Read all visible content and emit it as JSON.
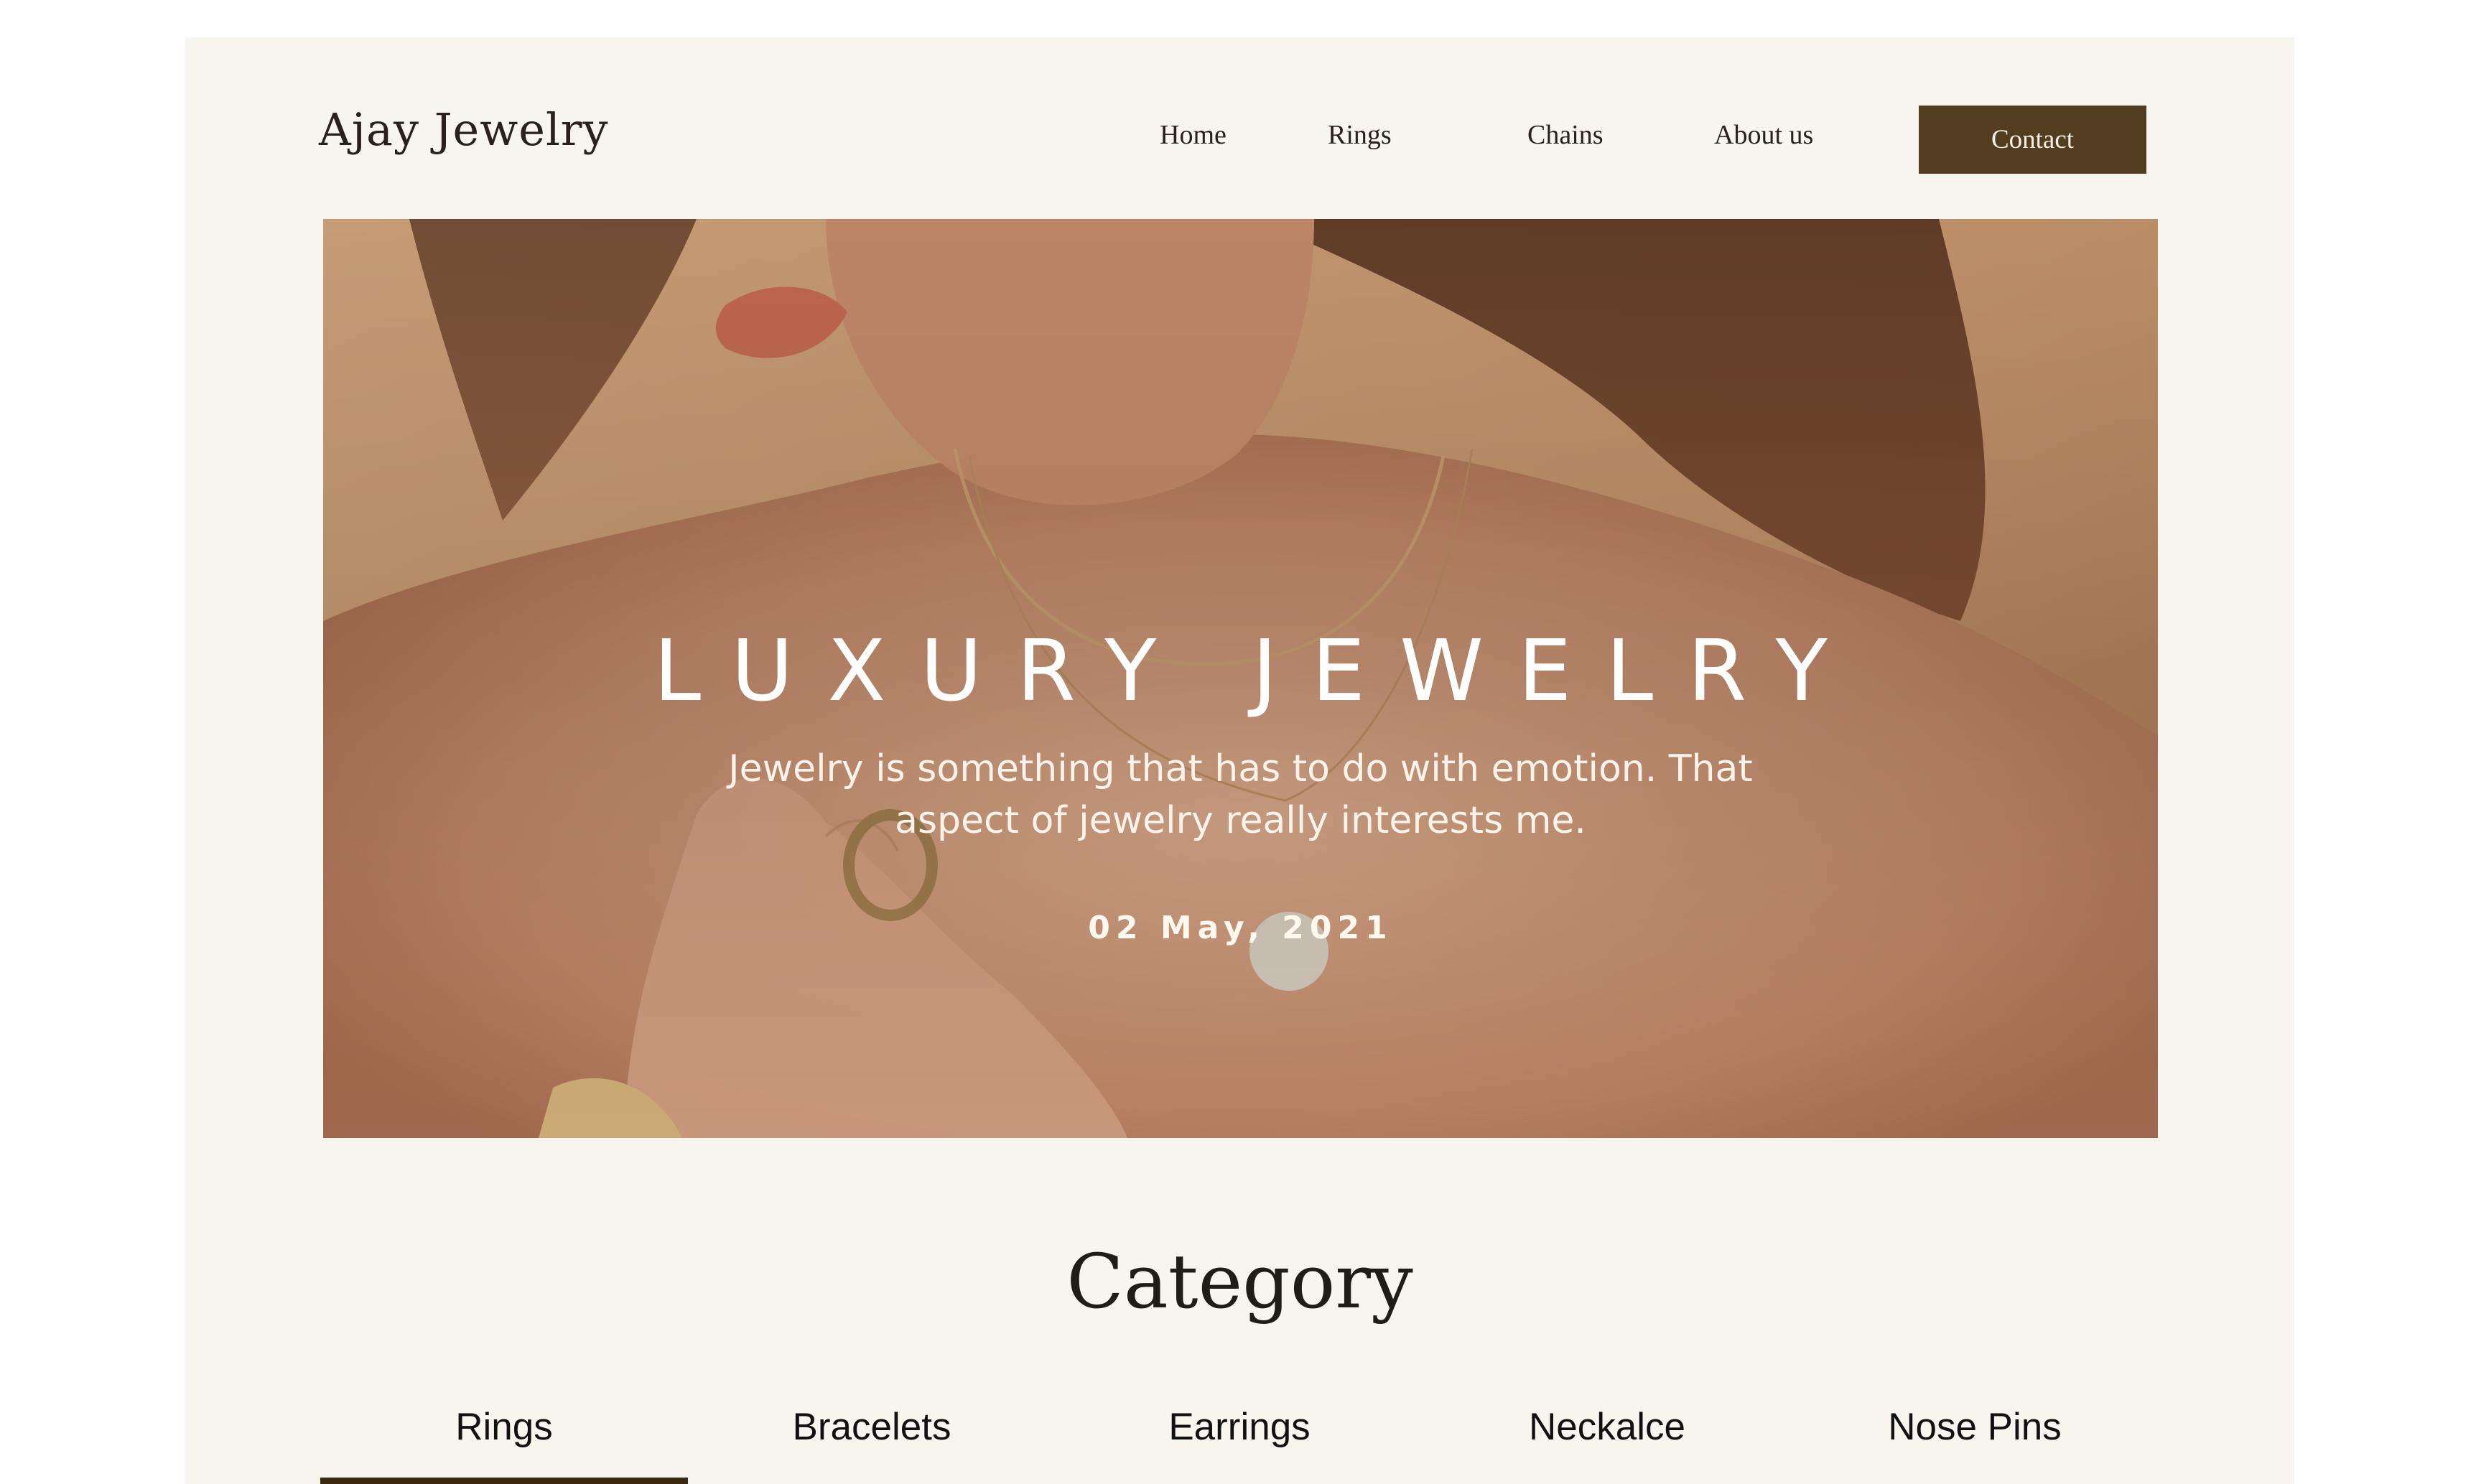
{
  "header": {
    "logo": "Ajay Jewelry",
    "nav": [
      {
        "label": "Home"
      },
      {
        "label": "Rings"
      },
      {
        "label": "Chains"
      },
      {
        "label": "About us"
      }
    ],
    "contact_label": "Contact"
  },
  "hero": {
    "title": "LUXURY JEWELRY",
    "subtitle_line1": "Jewelry is something that has to do with emotion. That",
    "subtitle_line2": "aspect of jewelry really interests me.",
    "date": "02 May, 2021"
  },
  "category": {
    "heading": "Category",
    "tabs": [
      {
        "label": "Rings"
      },
      {
        "label": "Bracelets"
      },
      {
        "label": "Earrings"
      },
      {
        "label": "Neckalce"
      },
      {
        "label": "Nose Pins"
      }
    ],
    "active_tab": "Rings"
  },
  "colors": {
    "page_background": "#f8f5ee",
    "accent_brown": "#523d20",
    "underline": "#3b2a12",
    "text_dark": "#2a211a"
  }
}
